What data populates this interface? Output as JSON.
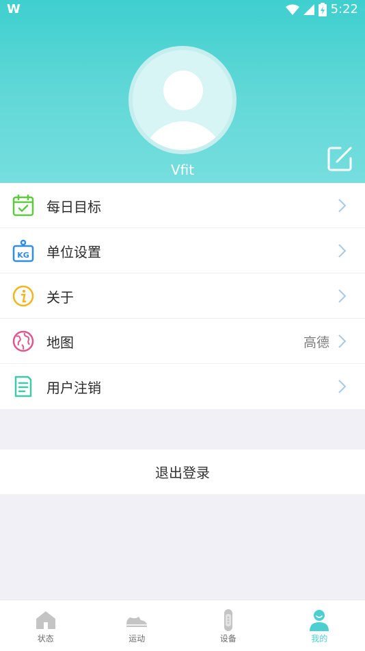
{
  "status_bar": {
    "logo": "W",
    "time": "5:22"
  },
  "profile": {
    "username": "Vfit"
  },
  "menu": {
    "items": [
      {
        "label": "每日目标",
        "value": "",
        "icon": "calendar-check-icon",
        "color": "#5cc93e"
      },
      {
        "label": "单位设置",
        "value": "",
        "icon": "kg-scale-icon",
        "color": "#2f8de4"
      },
      {
        "label": "关于",
        "value": "",
        "icon": "info-icon",
        "color": "#f2b51c"
      },
      {
        "label": "地图",
        "value": "高德",
        "icon": "globe-icon",
        "color": "#e0558f"
      },
      {
        "label": "用户注销",
        "value": "",
        "icon": "document-icon",
        "color": "#3fc9a6"
      }
    ]
  },
  "logout": {
    "label": "退出登录"
  },
  "bottom_nav": {
    "items": [
      {
        "label": "状态",
        "icon": "home-icon",
        "active": false
      },
      {
        "label": "运动",
        "icon": "shoe-icon",
        "active": false
      },
      {
        "label": "设备",
        "icon": "band-icon",
        "active": false
      },
      {
        "label": "我的",
        "icon": "person-icon",
        "active": true
      }
    ]
  },
  "colors": {
    "accent": "#4ccfcf",
    "header_top": "#3fcfcf",
    "background": "#f1f0f6",
    "chevron": "#a9c8e6"
  }
}
